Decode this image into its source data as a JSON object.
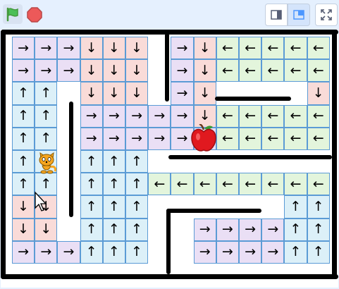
{
  "toolbar": {
    "green_flag_icon": "green-flag-icon",
    "stop_icon": "stop-sign-icon",
    "small_stage_icon": "small-stage-icon",
    "normal_stage_icon": "normal-stage-icon",
    "fullscreen_icon": "fullscreen-icon"
  },
  "colors": {
    "right": "#eadff5",
    "down": "#f9dbd8",
    "left": "#e3f5dc",
    "up": "#dcf0f8",
    "cell_border": "#5b9bd5",
    "wall": "#000000",
    "apple": "#e0191f"
  },
  "glyphs": {
    "R": "→",
    "L": "←",
    "U": "↑",
    "D": "↓"
  },
  "grid": {
    "rows": [
      "RRR.DDD.RD.LLLLL",
      "RRR.DDD.RD.LLLLL",
      "UU..DDD.RD.....D",
      "UU..RRRRRD.LLLLL",
      "UU..RRRRRR.LLLLL",
      "UU..UUU...........",
      "UU..UUULLLLLLLLL",
      "DD..UUU.........UU",
      "DD..UUU..RRRRUU",
      "RRR.UUU..RRRRUU"
    ]
  },
  "sprites": {
    "cat_icon": "cat-sprite-icon",
    "apple_icon": "apple-icon",
    "cursor_icon": "mouse-cursor-icon"
  }
}
